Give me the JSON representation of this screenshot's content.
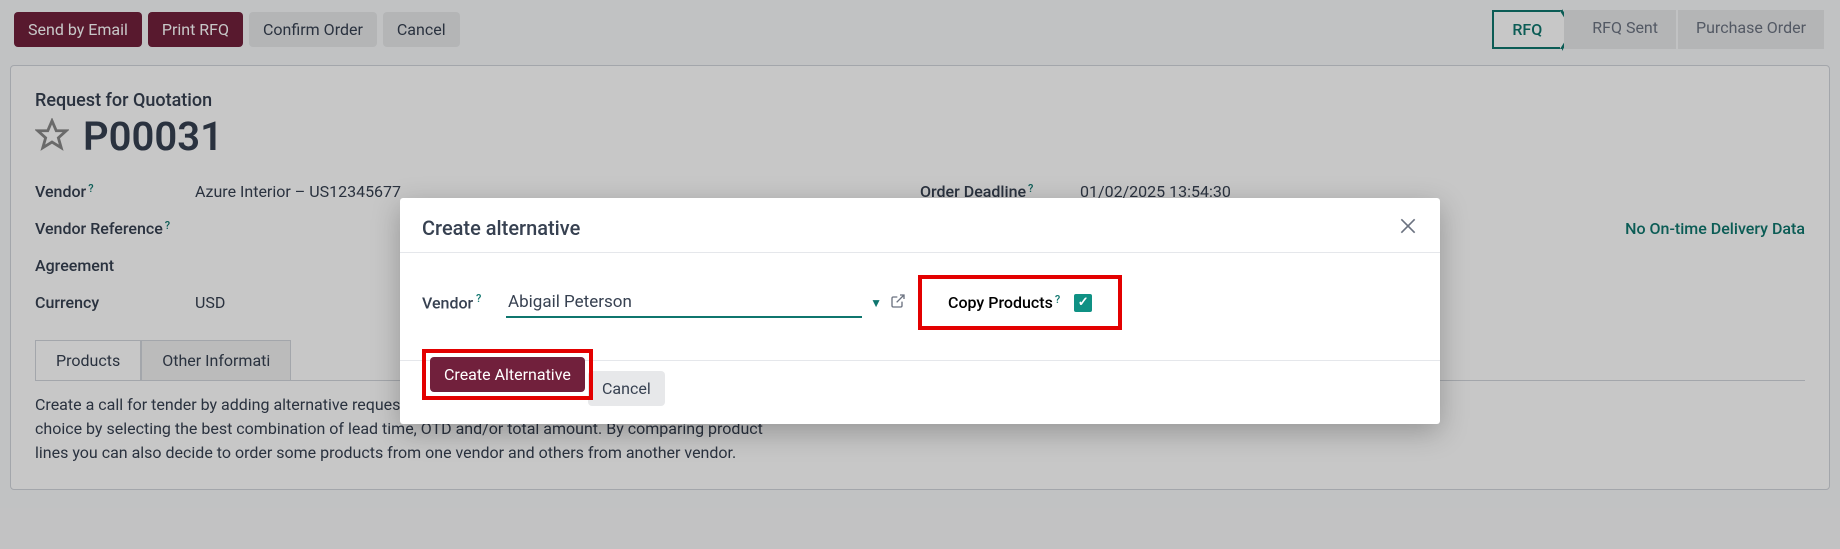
{
  "toolbar": {
    "send_email": "Send by Email",
    "print_rfq": "Print RFQ",
    "confirm": "Confirm Order",
    "cancel": "Cancel"
  },
  "status": {
    "rfq": "RFQ",
    "rfq_sent": "RFQ Sent",
    "po": "Purchase Order"
  },
  "header": {
    "label": "Request for Quotation",
    "number": "P00031"
  },
  "fields": {
    "vendor_label": "Vendor",
    "vendor_value": "Azure Interior – US12345677",
    "deadline_label": "Order Deadline",
    "deadline_value": "01/02/2025 13:54:30",
    "vendor_ref_label": "Vendor Reference",
    "delivery_data": "No On-time Delivery Data",
    "agreement_label": "Agreement",
    "currency_label": "Currency",
    "currency_value": "USD"
  },
  "tabs": {
    "products": "Products",
    "other": "Other Informati"
  },
  "tender_text": "Create a call for tender by adding alternative requests for quotation to different vendors. Make your choice by selecting the best combination of lead time, OTD and/or total amount. By comparing product lines you can also decide to order some products from one vendor and others from another vendor.",
  "modal": {
    "title": "Create alternative",
    "vendor_label": "Vendor",
    "vendor_value": "Abigail Peterson",
    "copy_label": "Copy Products",
    "create_btn": "Create Alternative",
    "cancel_btn": "Cancel"
  }
}
